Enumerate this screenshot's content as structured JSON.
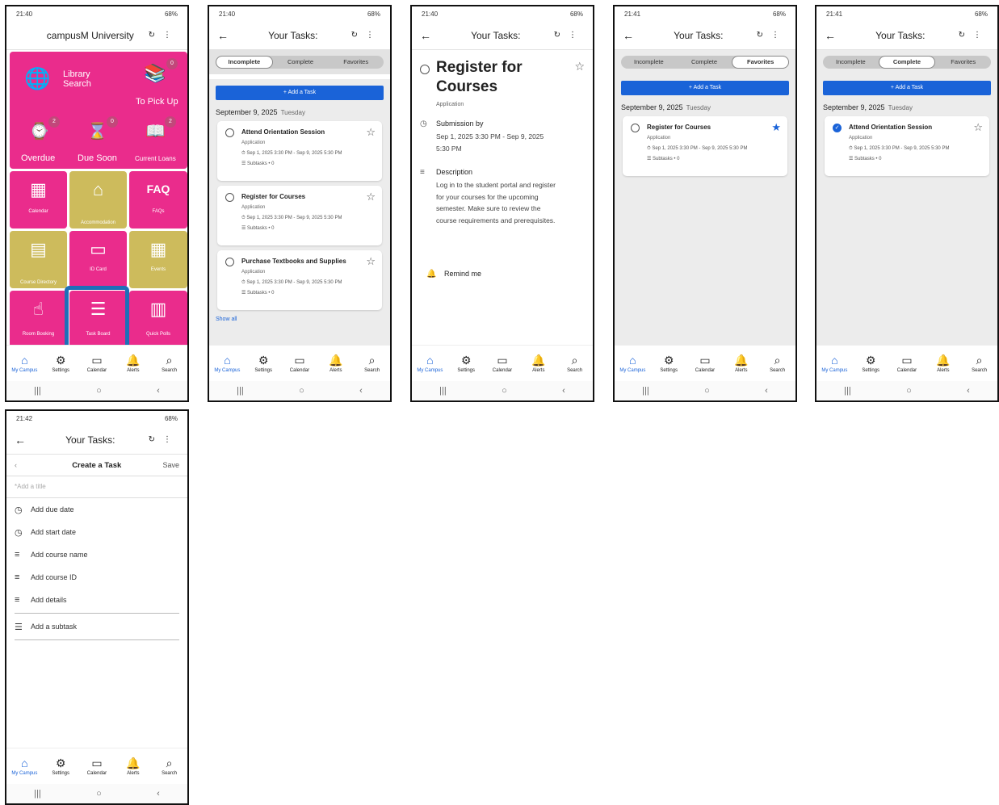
{
  "nav": {
    "my_campus": "My Campus",
    "settings": "Settings",
    "calendar": "Calendar",
    "alerts": "Alerts",
    "search": "Search"
  },
  "sysnav": {
    "recents": "|||",
    "home": "○",
    "back": "‹"
  },
  "phone1": {
    "time": "21:40",
    "status_right": "68%",
    "title": "campusM University",
    "tiles": {
      "library_search": "Library Search",
      "to_pick_up": "To Pick Up",
      "to_pick_up_badge": "0",
      "overdue": "Overdue",
      "overdue_badge": "2",
      "due_soon": "Due Soon",
      "due_soon_badge": "0",
      "current_loans": "Current Loans",
      "current_loans_badge": "2",
      "calendar": "Calendar",
      "accommodation": "Accommodation",
      "faqs": "FAQs",
      "course_directory": "Course Directory",
      "id_card": "ID Card",
      "events": "Events",
      "room_booking": "Room Booking",
      "task_board": "Task Board",
      "quick_polls": "Quick Polls"
    }
  },
  "tasks_common": {
    "title": "Your Tasks:",
    "tab_incomplete": "Incomplete",
    "tab_complete": "Complete",
    "tab_favorites": "Favorites",
    "add_task": "+ Add a Task",
    "date": "September 9, 2025",
    "weekday": "Tuesday",
    "category": "Application",
    "dates": "Sep 1, 2025 3:30 PM - Sep 9, 2025 5:30 PM",
    "subtasks": "Subtasks • 0",
    "show_all": "Show all"
  },
  "phone2": {
    "time": "21:40",
    "status_right": "68%",
    "tasks": [
      {
        "title": "Attend Orientation Session"
      },
      {
        "title": "Register for Courses"
      },
      {
        "title": "Purchase Textbooks and Supplies"
      }
    ]
  },
  "phone3": {
    "time": "21:40",
    "status_right": "68%",
    "task_title": "Register for Courses",
    "category": "Application",
    "submission_label": "Submission by",
    "submission_value": "Sep 1, 2025 3:30 PM - Sep 9, 2025 5:30 PM",
    "description_label": "Description",
    "description": "Log in to the student portal and register for your courses for the upcoming semester. Make sure to review the course requirements and prerequisites.",
    "remind_me": "Remind me"
  },
  "phone4": {
    "time": "21:41",
    "status_right": "68%",
    "task": {
      "title": "Register for Courses"
    }
  },
  "phone5": {
    "time": "21:41",
    "status_right": "68%",
    "task": {
      "title": "Attend Orientation Session"
    }
  },
  "phone6": {
    "time": "21:42",
    "status_right": "68%",
    "bar_title": "Create a Task",
    "save": "Save",
    "title_placeholder": "*Add a title",
    "rows": {
      "due_date": "Add due date",
      "start_date": "Add start date",
      "course_name": "Add course name",
      "course_id": "Add course ID",
      "details": "Add details",
      "subtask": "Add a subtask"
    }
  },
  "colors": {
    "accent": "#1a63d8",
    "pink_tile": "#ea2c8c",
    "gold_tile": "#cdbb5c",
    "highlight": "#1e6fb8"
  }
}
